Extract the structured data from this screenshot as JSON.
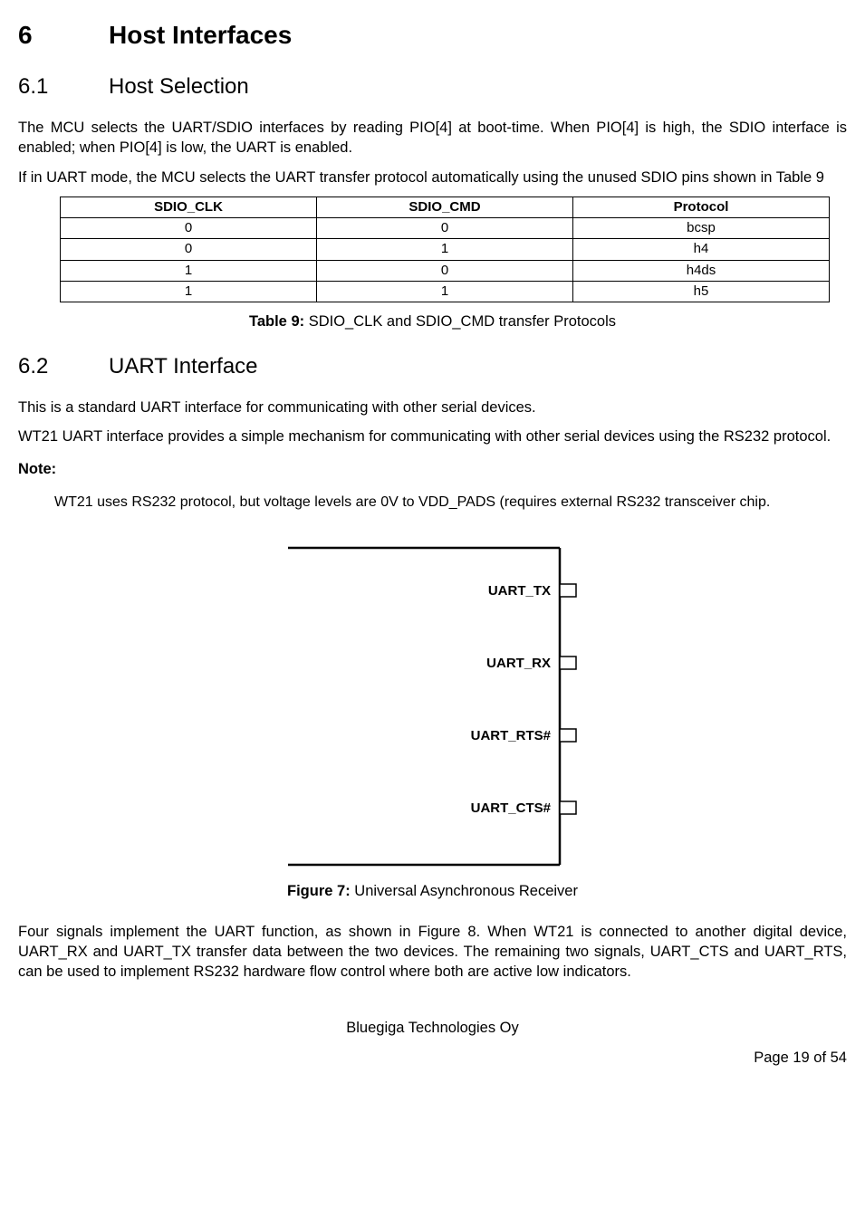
{
  "h1": {
    "num": "6",
    "title": "Host Interfaces"
  },
  "sec61": {
    "num": "6.1",
    "title": "Host Selection",
    "p1": "The MCU selects the UART/SDIO interfaces by reading PIO[4] at boot-time. When PIO[4] is high, the SDIO interface is enabled; when PIO[4] is low, the UART is enabled.",
    "p2": "If in UART mode, the MCU selects the UART transfer protocol automatically using the unused SDIO pins shown in Table 9"
  },
  "table9": {
    "headers": [
      "SDIO_CLK",
      "SDIO_CMD",
      "Protocol"
    ],
    "rows": [
      [
        "0",
        "0",
        "bcsp"
      ],
      [
        "0",
        "1",
        "h4"
      ],
      [
        "1",
        "0",
        "h4ds"
      ],
      [
        "1",
        "1",
        "h5"
      ]
    ],
    "caption_bold": "Table 9:",
    "caption_rest": " SDIO_CLK and SDIO_CMD transfer Protocols"
  },
  "sec62": {
    "num": "6.2",
    "title": "UART Interface",
    "p1": "This is a standard UART interface for communicating with other serial devices.",
    "p2": "WT21 UART interface provides a simple mechanism for communicating with other serial devices using the RS232 protocol.",
    "note_label": "Note:",
    "note_body": "WT21 uses RS232 protocol, but voltage levels are 0V to VDD_PADS (requires external RS232 transceiver chip."
  },
  "figure7": {
    "labels": [
      "UART_TX",
      "UART_RX",
      "UART_RTS#",
      "UART_CTS#"
    ],
    "caption_bold": "Figure 7:",
    "caption_rest": " Universal Asynchronous Receiver",
    "p_after": "Four signals implement the UART function, as shown in Figure 8. When WT21 is connected to another digital device, UART_RX and UART_TX transfer data between the two devices. The remaining two signals, UART_CTS and UART_RTS, can be used to implement RS232 hardware flow control where both are active low indicators."
  },
  "footer": {
    "company": "Bluegiga Technologies Oy",
    "page": "Page 19 of 54"
  }
}
